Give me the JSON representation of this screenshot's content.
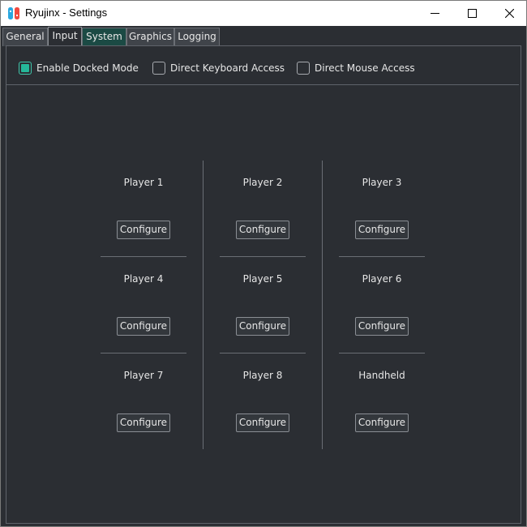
{
  "window": {
    "title": "Ryujinx - Settings"
  },
  "tabs": [
    {
      "label": "General",
      "active": false
    },
    {
      "label": "Input",
      "active": true
    },
    {
      "label": "System",
      "active": false
    },
    {
      "label": "Graphics",
      "active": false
    },
    {
      "label": "Logging",
      "active": false
    }
  ],
  "options": {
    "docked": {
      "label": "Enable Docked Mode",
      "checked": true
    },
    "keyboard": {
      "label": "Direct Keyboard Access",
      "checked": false
    },
    "mouse": {
      "label": "Direct Mouse Access",
      "checked": false
    }
  },
  "players": [
    {
      "label": "Player 1",
      "button": "Configure"
    },
    {
      "label": "Player 2",
      "button": "Configure"
    },
    {
      "label": "Player 3",
      "button": "Configure"
    },
    {
      "label": "Player 4",
      "button": "Configure"
    },
    {
      "label": "Player 5",
      "button": "Configure"
    },
    {
      "label": "Player 6",
      "button": "Configure"
    },
    {
      "label": "Player 7",
      "button": "Configure"
    },
    {
      "label": "Player 8",
      "button": "Configure"
    },
    {
      "label": "Handheld",
      "button": "Configure"
    }
  ],
  "colors": {
    "background": "#2b2e33",
    "accent": "#25b89a",
    "system_tab": "#1b4a44"
  }
}
